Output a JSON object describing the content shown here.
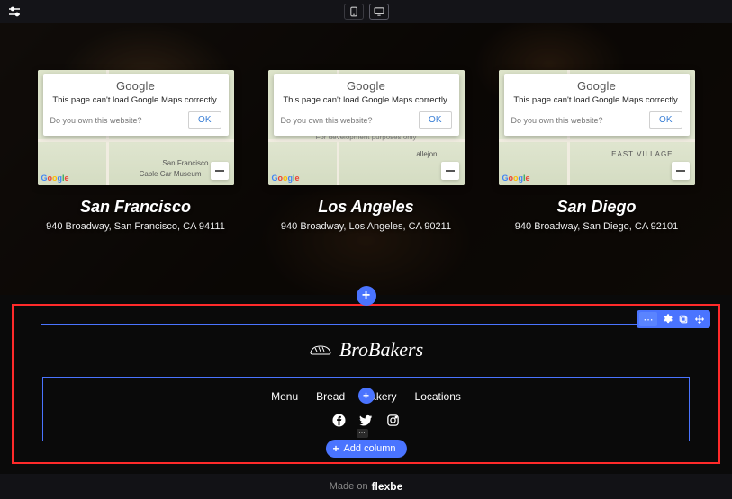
{
  "toolbar": {
    "viewport_mobile": "mobile",
    "viewport_desktop": "desktop"
  },
  "maps": {
    "modal_title": "Google",
    "modal_msg": "This page can't load Google Maps correctly.",
    "modal_link": "Do you own this website?",
    "modal_ok": "OK",
    "dev_text": "For development purposes only",
    "logo_text": "Google"
  },
  "locations": [
    {
      "title": "San Francisco",
      "address": "940 Broadway, San Francisco, CA 94111",
      "map_labels": [
        "San Francisco",
        "Cable Car Museum"
      ]
    },
    {
      "title": "Los Angeles",
      "address": "940 Broadway, Los Angeles, CA 90211",
      "map_labels": [
        "allejon"
      ]
    },
    {
      "title": "San Diego",
      "address": "940 Broadway, San Diego, CA 92101",
      "map_labels": [
        "EAST VILLAGE"
      ]
    }
  ],
  "footer_block": {
    "brand": "BroBakers",
    "nav": [
      "Menu",
      "Bread",
      "Bakery",
      "Locations"
    ],
    "social_badge": "⋯",
    "add_column": "Add column"
  },
  "credit": {
    "prefix": "Made on",
    "name": "flexbe"
  }
}
